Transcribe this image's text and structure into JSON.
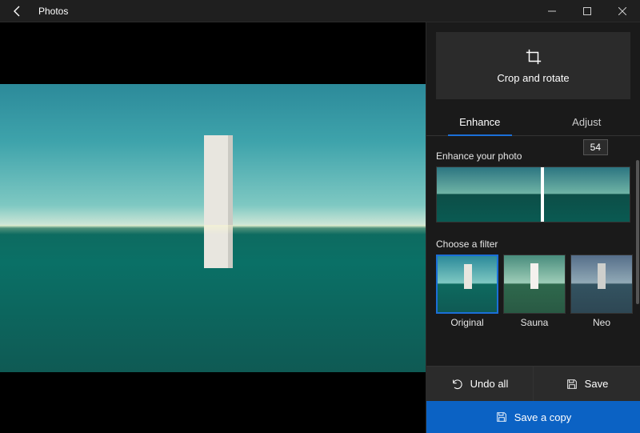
{
  "titlebar": {
    "title": "Photos"
  },
  "sidebar": {
    "crop_label": "Crop and rotate",
    "tabs": {
      "enhance": "Enhance",
      "adjust": "Adjust"
    },
    "enhance": {
      "label": "Enhance your photo",
      "value": "54"
    },
    "filters": {
      "label": "Choose a filter",
      "items": [
        {
          "label": "Original",
          "selected": true
        },
        {
          "label": "Sauna",
          "selected": false
        },
        {
          "label": "Neo",
          "selected": false
        }
      ]
    },
    "actions": {
      "undo": "Undo all",
      "save": "Save",
      "save_copy": "Save a copy"
    }
  }
}
